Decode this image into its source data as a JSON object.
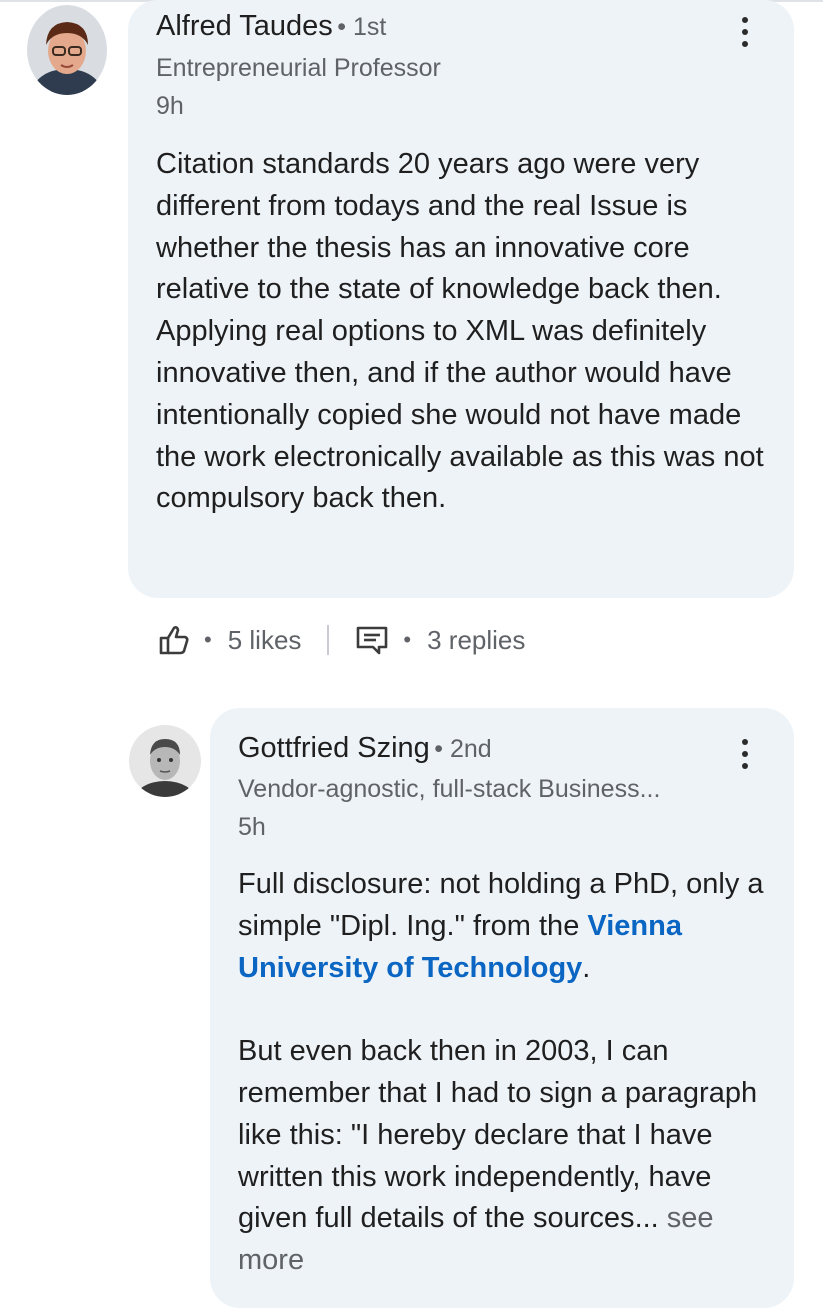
{
  "comment1": {
    "author": "Alfred Taudes",
    "degree": "1st",
    "headline": "Entrepreneurial Professor",
    "time": "9h",
    "text": "Citation standards 20 years ago were very different from todays and the real Issue is whether the thesis has an innovative core relative to the state of knowledge back then. Applying real options to XML was definitely innovative then, and if the author would have intentionally copied she would not have made the work electronically available as this was not compulsory back then.",
    "likes": "5 likes",
    "replies": "3 replies",
    "icons": {
      "avatar": "profile-photo",
      "like": "thumbs-up-icon",
      "reply": "comment-icon",
      "more": "more-vertical-icon"
    }
  },
  "reply1": {
    "author": "Gottfried Szing",
    "degree": "2nd",
    "headline": "Vendor-agnostic, full-stack Business...",
    "time": "5h",
    "para1_before": "Full disclosure: not holding a PhD, only a simple \"Dipl. Ing.\" from the",
    "para1_link": "Vienna University of Technology",
    "para1_after": ".",
    "para2": "But even back then in 2003, I can remember that I had to sign a paragraph like this: \"I hereby declare that I have written this work independently, have given full details of the sources",
    "ellipsis": "...",
    "see_more": "see more",
    "icons": {
      "avatar": "profile-photo",
      "more": "more-vertical-icon"
    }
  },
  "colors": {
    "bubble": "#eef3f8",
    "link": "#0a66c2",
    "secondary_text": "#5f6368"
  }
}
